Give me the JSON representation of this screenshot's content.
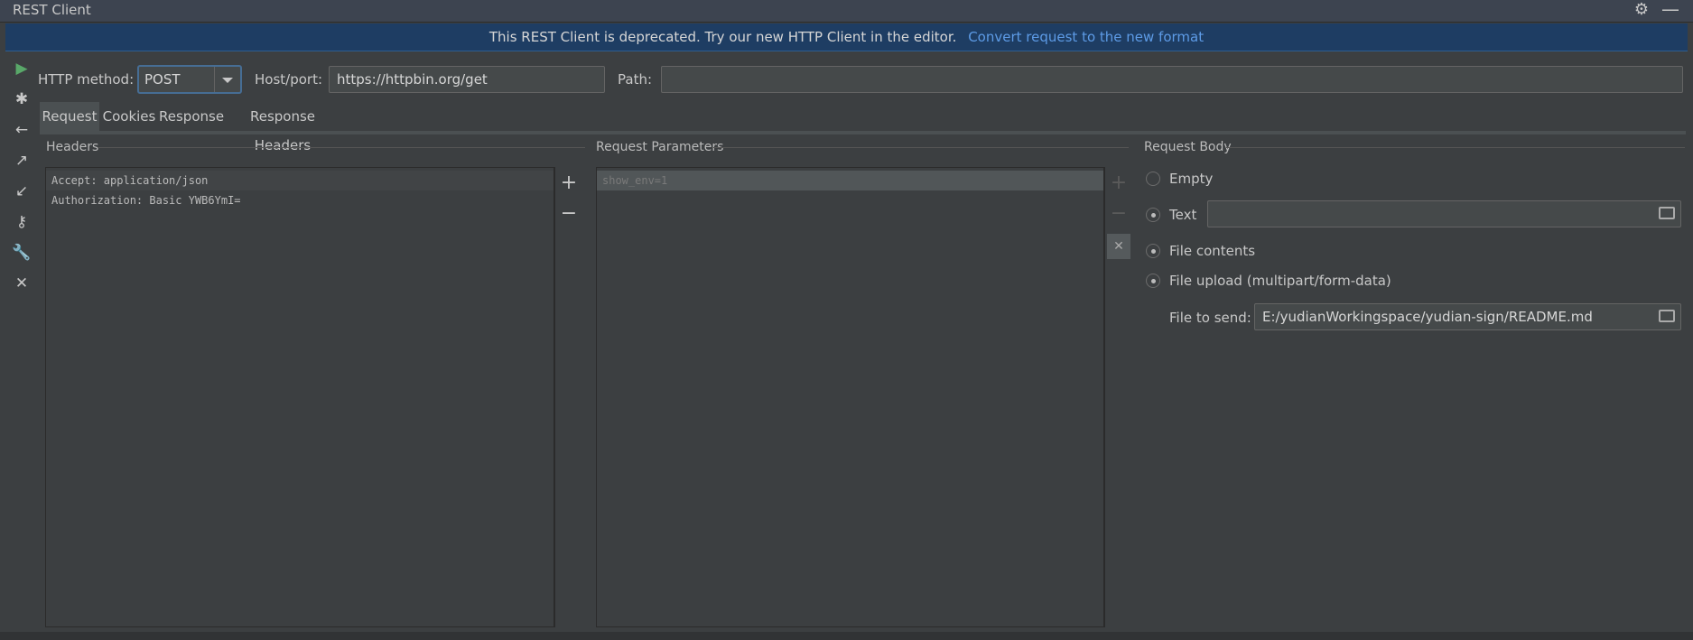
{
  "window": {
    "title": "REST Client"
  },
  "banner": {
    "message": "This REST Client is deprecated. Try our new HTTP Client in the editor.",
    "link": "Convert request to the new format"
  },
  "toolbar": {
    "http_method_label": "HTTP method:",
    "http_method_value": "POST",
    "host_label": "Host/port:",
    "host_value": "https://httpbin.org/get",
    "path_label": "Path:",
    "path_value": ""
  },
  "tabs": [
    {
      "label": "Request",
      "active": true
    },
    {
      "label": "Cookies",
      "active": false
    },
    {
      "label": "Response",
      "active": false
    },
    {
      "label": "Response Headers",
      "active": false
    }
  ],
  "headers": {
    "title": "Headers",
    "rows": [
      "Accept: application/json",
      "Authorization: Basic YWB6YmI="
    ]
  },
  "params": {
    "title": "Request Parameters",
    "rows": [
      "show_env=1"
    ]
  },
  "body": {
    "title": "Request Body",
    "options": [
      "Empty",
      "Text",
      "File contents",
      "File upload (multipart/form-data)"
    ],
    "file_to_send_label": "File to send:",
    "file_to_send_value": "E:/yudianWorkingspace/yudian-sign/README.md"
  }
}
